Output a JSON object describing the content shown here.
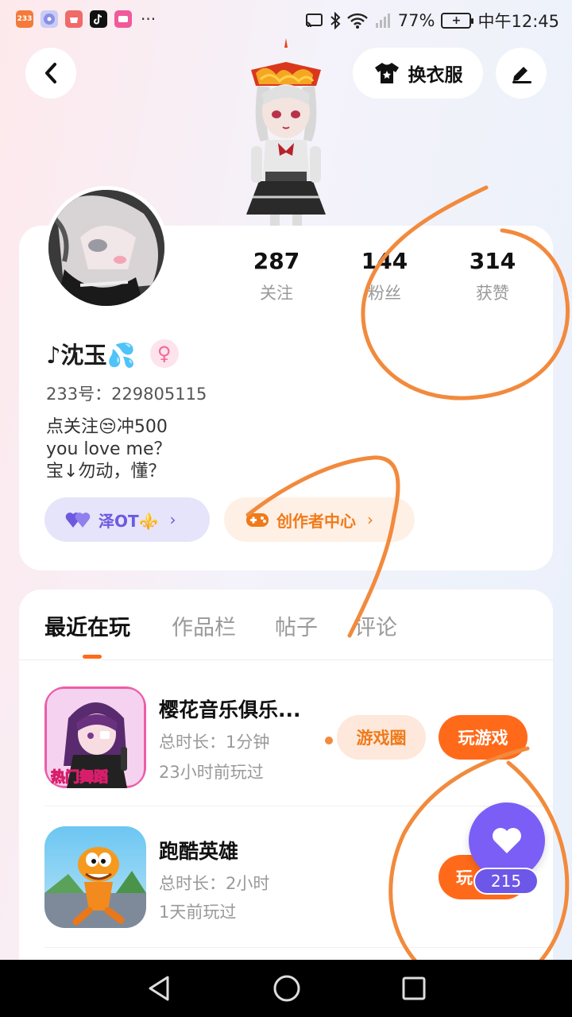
{
  "status_bar": {
    "apps": [
      {
        "icon": "app-233-icon",
        "label": "233",
        "color": "#f47a3a"
      },
      {
        "icon": "music-app-icon",
        "label": "",
        "color": "#8a8fe8"
      },
      {
        "icon": "store-app-icon",
        "label": "",
        "color": "#f06a6a"
      },
      {
        "icon": "tiktok-app-icon",
        "label": "",
        "color": "#111111"
      },
      {
        "icon": "video-app-icon",
        "label": "",
        "color": "#f05a9a"
      }
    ],
    "battery": "77%",
    "time": "中午12:45"
  },
  "header": {
    "dress_label": "换衣服"
  },
  "profile": {
    "stats": [
      {
        "value": "287",
        "label": "关注"
      },
      {
        "value": "144",
        "label": "粉丝"
      },
      {
        "value": "314",
        "label": "获赞"
      }
    ],
    "name": "♪沈玉💦",
    "gender_symbol": "♀",
    "uid": "233号：229805115",
    "bio": [
      "点关注😒冲500",
      "you love me？",
      "宝↓勿动，懂？"
    ],
    "pill_friend": "泽OT⚜️",
    "pill_creator": "创作者中心"
  },
  "tabs": [
    "最近在玩",
    "作品栏",
    "帖子",
    "评论"
  ],
  "games": [
    {
      "title": "樱花音乐俱乐...",
      "duration": "总时长：1分钟",
      "last_played": "23小时前玩过",
      "icon_label": "热门舞蹈",
      "circle_label": "游戏圈",
      "play_label": "玩游戏"
    },
    {
      "title": "跑酷英雄",
      "duration": "总时长：2小时",
      "last_played": "1天前玩过",
      "play_label": "玩"
    }
  ],
  "float_like": {
    "count": "215"
  },
  "colors": {
    "accent": "#ff6a1a",
    "purple": "#7b5ef5",
    "annotation": "#f28a3c"
  }
}
